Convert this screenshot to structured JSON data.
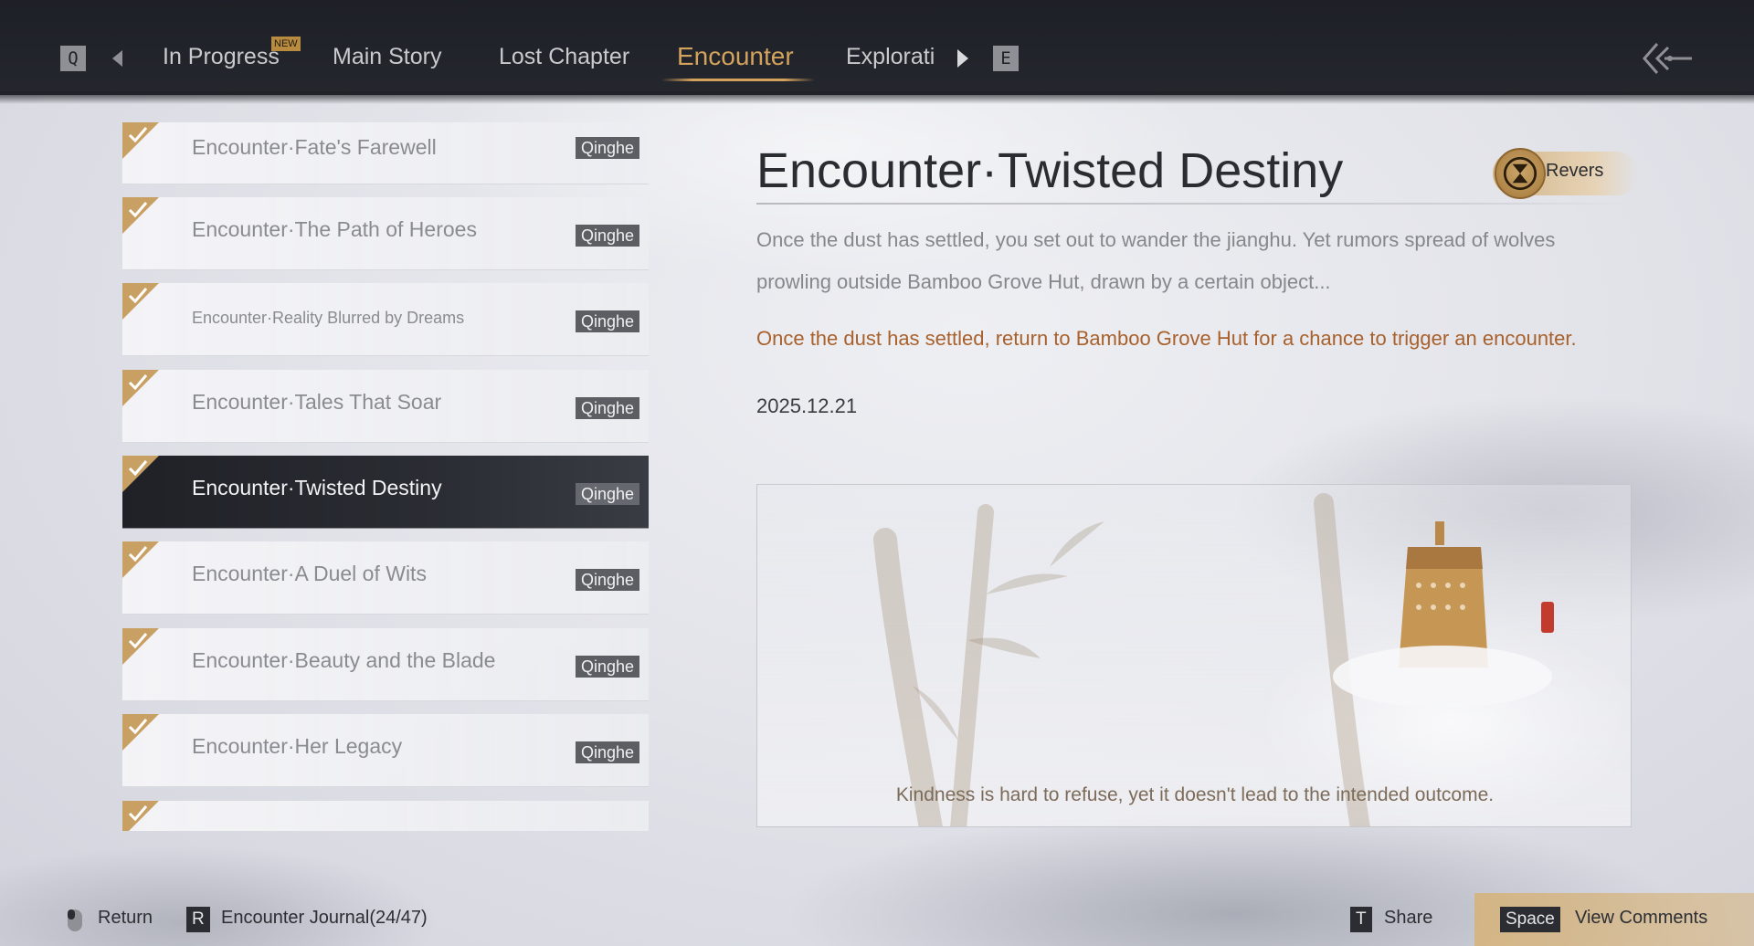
{
  "nav": {
    "left_key": "Q",
    "right_key": "E",
    "tabs": [
      {
        "label": "In Progress",
        "badge": "NEW"
      },
      {
        "label": "Main Story"
      },
      {
        "label": "Lost Chapter"
      },
      {
        "label": "Encounter"
      },
      {
        "label": "Explorati"
      }
    ],
    "active_tab": "Encounter"
  },
  "list": {
    "items": [
      {
        "title": "Encounter·Fate's Farewell",
        "tag": "Qinghe"
      },
      {
        "title": "Encounter·The Path of Heroes",
        "tag": "Qinghe"
      },
      {
        "title": "Encounter·Reality Blurred by Dreams",
        "tag": "Qinghe"
      },
      {
        "title": "Encounter·Tales That Soar",
        "tag": "Qinghe"
      },
      {
        "title": "Encounter·Twisted Destiny",
        "tag": "Qinghe"
      },
      {
        "title": "Encounter·A Duel of Wits",
        "tag": "Qinghe"
      },
      {
        "title": "Encounter·Beauty and the Blade",
        "tag": "Qinghe"
      },
      {
        "title": "Encounter·Her Legacy",
        "tag": "Qinghe"
      },
      {
        "title": "",
        "tag": ""
      }
    ],
    "selected": "Encounter·Twisted Destiny"
  },
  "detail": {
    "title": "Encounter·Twisted Destiny",
    "reverse_label": "Revers",
    "description_line1": "Once the dust has settled, you set out to wander the jianghu. Yet rumors spread of wolves",
    "description_line2": "prowling outside Bamboo Grove Hut, drawn by a certain object...",
    "hint": "Once the dust has settled, return to Bamboo Grove Hut for a chance to trigger an encounter.",
    "date": "2025.12.21",
    "art_caption": "Kindness is hard to refuse, yet it doesn't lead to the intended outcome."
  },
  "footer": {
    "return_label": "Return",
    "journal_key": "R",
    "journal_label": "Encounter Journal(24/47)",
    "share_key": "T",
    "share_label": "Share",
    "comments_key": "Space",
    "comments_label": "View Comments"
  },
  "colors": {
    "accent_gold": "#d3a25c",
    "hint_orange": "#a8612c",
    "topbar": "#1d2026",
    "selected_row": "#1f2127"
  }
}
